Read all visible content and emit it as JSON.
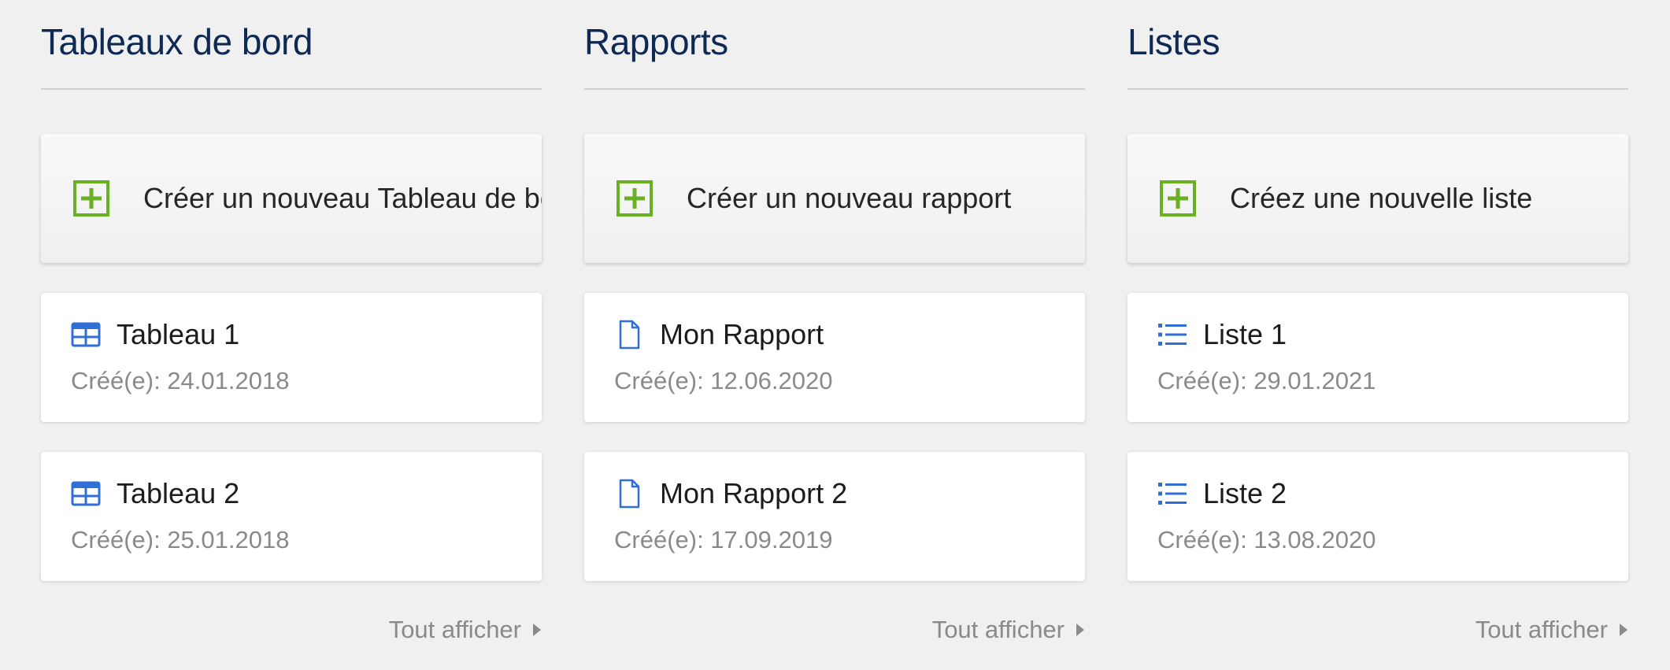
{
  "colors": {
    "background": "#f0f0f0",
    "title": "#0e2a54",
    "plus_icon_green": "#6ab023",
    "item_icon_blue": "#2f6fd6",
    "date_text": "#8a8a8a"
  },
  "sections": [
    {
      "title": "Tableaux de bord",
      "create_label": "Créer un nouveau Tableau de bord",
      "item_icon": "table-icon",
      "items": [
        {
          "title": "Tableau 1",
          "date": "Créé(e): 24.01.2018"
        },
        {
          "title": "Tableau 2",
          "date": "Créé(e): 25.01.2018"
        }
      ],
      "show_all": "Tout afficher"
    },
    {
      "title": "Rapports",
      "create_label": "Créer un nouveau rapport",
      "item_icon": "document-icon",
      "items": [
        {
          "title": "Mon Rapport",
          "date": "Créé(e): 12.06.2020"
        },
        {
          "title": "Mon Rapport 2",
          "date": "Créé(e): 17.09.2019"
        }
      ],
      "show_all": "Tout afficher"
    },
    {
      "title": "Listes",
      "create_label": "Créez une nouvelle liste",
      "item_icon": "list-icon",
      "items": [
        {
          "title": "Liste 1",
          "date": "Créé(e): 29.01.2021"
        },
        {
          "title": "Liste 2",
          "date": "Créé(e): 13.08.2020"
        }
      ],
      "show_all": "Tout afficher"
    }
  ]
}
